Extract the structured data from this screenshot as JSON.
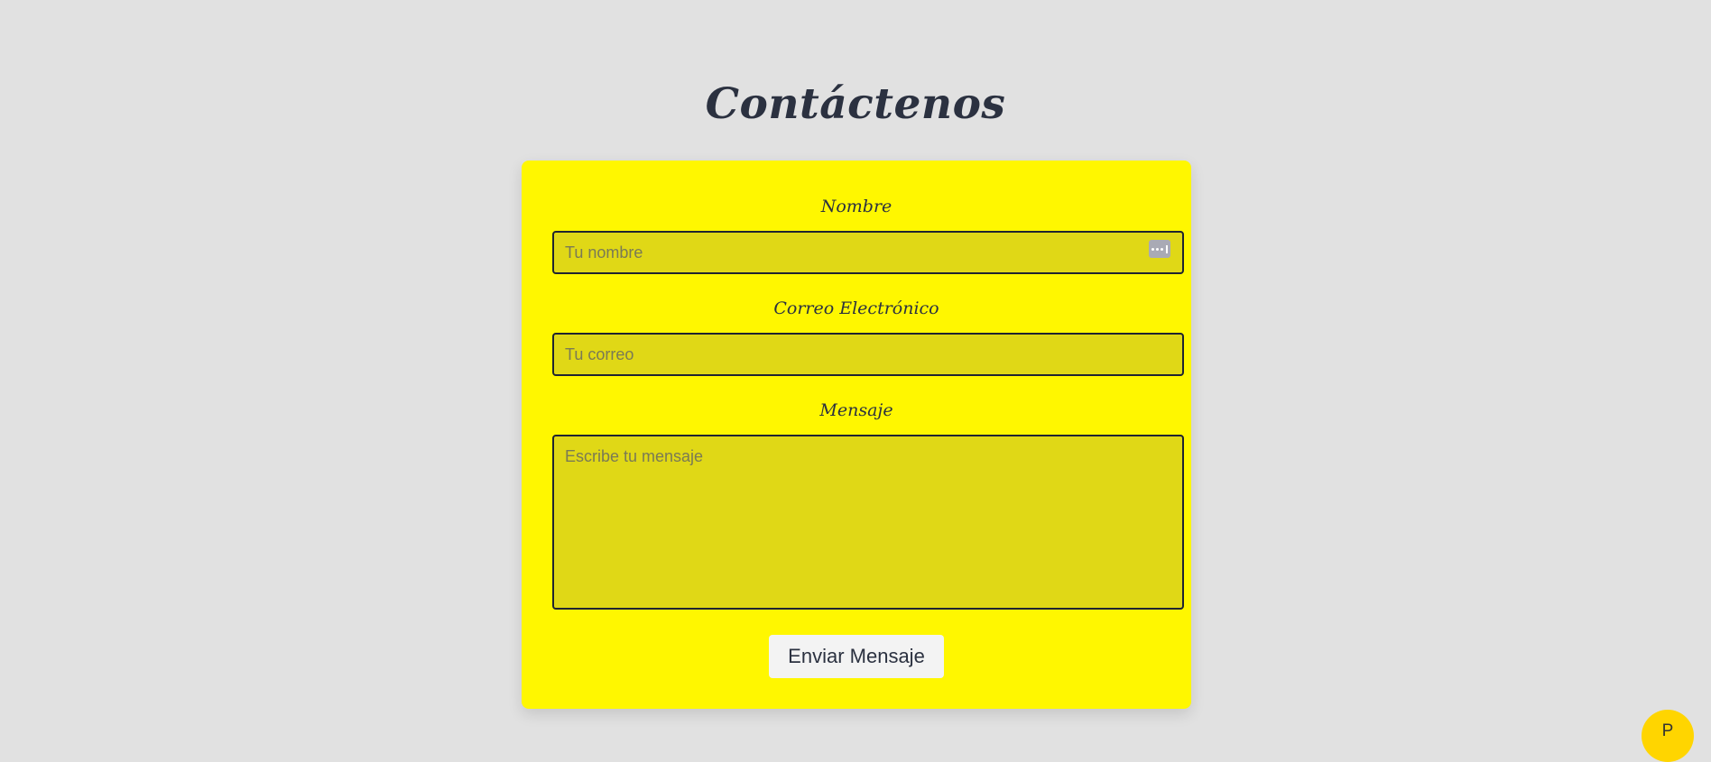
{
  "page": {
    "title": "Contáctenos"
  },
  "form": {
    "name_label": "Nombre",
    "name_placeholder": "Tu nombre",
    "email_label": "Correo Electrónico",
    "email_placeholder": "Tu correo",
    "message_label": "Mensaje",
    "message_placeholder": "Escribe tu mensaje",
    "submit_label": "Enviar Mensaje",
    "autofill_icon": "password-manager-icon"
  },
  "floating_button": {
    "label": "P"
  },
  "colors": {
    "background": "#e1e1e1",
    "card": "#fff700",
    "field": "#e0d816",
    "text": "#2b3140",
    "floating_button": "#ffd500"
  }
}
